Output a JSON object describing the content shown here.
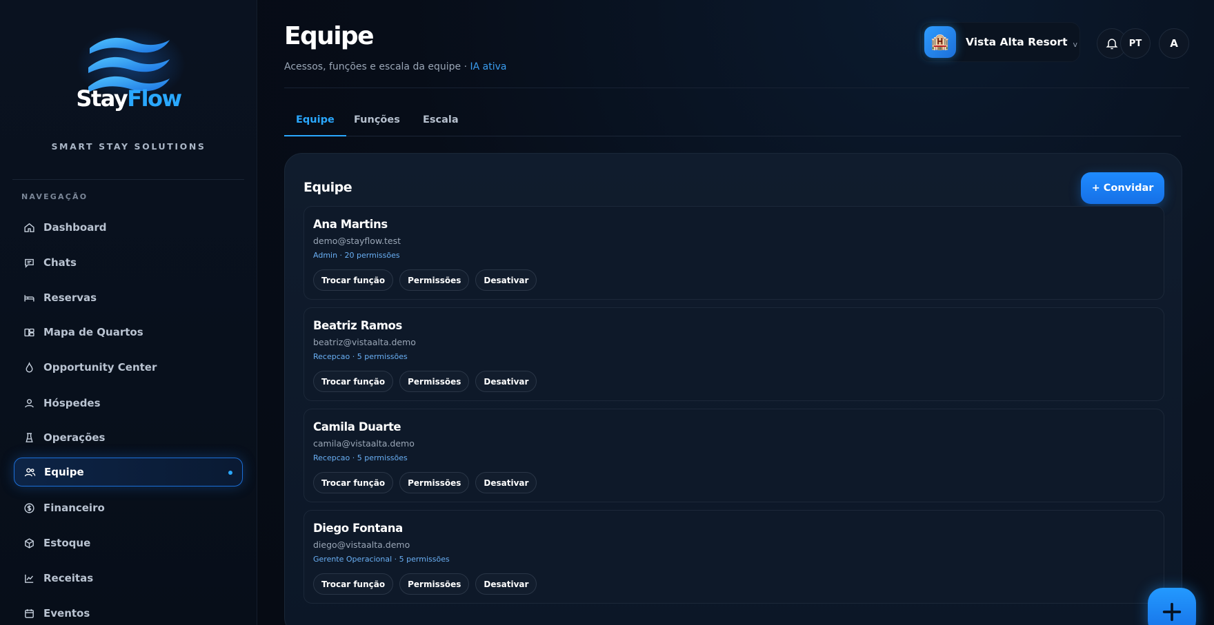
{
  "brand": {
    "name_part1": "Stay",
    "name_part2": "Flow",
    "tagline": "SMART STAY SOLUTIONS"
  },
  "sidebar": {
    "heading": "NAVEGAÇÃO",
    "items": [
      {
        "label": "Dashboard",
        "icon": "home-icon"
      },
      {
        "label": "Chats",
        "icon": "chat-icon"
      },
      {
        "label": "Reservas",
        "icon": "bed-icon"
      },
      {
        "label": "Mapa de Quartos",
        "icon": "grid-icon"
      },
      {
        "label": "Opportunity Center",
        "icon": "flame-icon"
      },
      {
        "label": "Hóspedes",
        "icon": "user-icon"
      },
      {
        "label": "Operações",
        "icon": "operations-icon"
      },
      {
        "label": "Equipe",
        "icon": "team-icon",
        "active": true
      },
      {
        "label": "Financeiro",
        "icon": "dollar-icon"
      },
      {
        "label": "Estoque",
        "icon": "box-icon"
      },
      {
        "label": "Receitas",
        "icon": "chart-icon"
      },
      {
        "label": "Eventos",
        "icon": "calendar-icon"
      }
    ]
  },
  "header": {
    "title": "Equipe",
    "subtitle": "Acessos, funções e escala da equipe · ",
    "ai_status": "IA ativa",
    "hotel_name": "Vista Alta Resort",
    "hotel_caret": "v",
    "language": "PT",
    "avatar_initial": "A"
  },
  "tabs": [
    {
      "label": "Equipe",
      "active": true
    },
    {
      "label": "Funções",
      "active": false
    },
    {
      "label": "Escala",
      "active": false
    }
  ],
  "panel": {
    "title": "Equipe",
    "invite_label": "+ Convidar"
  },
  "members": [
    {
      "name": "Ana Martins",
      "email": "demo@stayflow.test",
      "role": "Admin · 20 permissões"
    },
    {
      "name": "Beatriz Ramos",
      "email": "beatriz@vistaalta.demo",
      "role": "Recepcao · 5 permissões"
    },
    {
      "name": "Camila Duarte",
      "email": "camila@vistaalta.demo",
      "role": "Recepcao · 5 permissões"
    },
    {
      "name": "Diego Fontana",
      "email": "diego@vistaalta.demo",
      "role": "Gerente Operacional · 5 permissões"
    }
  ],
  "member_actions": {
    "change_role": "Trocar função",
    "permissions": "Permissões",
    "deactivate": "Desativar"
  },
  "colors": {
    "accent": "#2aa8ff",
    "primary_button": "#1e8bff",
    "background": "#060b14",
    "panel": "#101c2d",
    "role_text": "#6ab0f5"
  }
}
